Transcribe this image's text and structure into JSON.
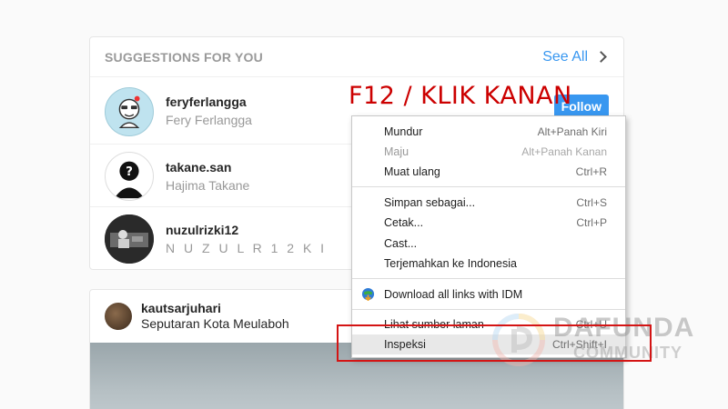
{
  "suggestions": {
    "title": "SUGGESTIONS FOR YOU",
    "see_all": "See All",
    "items": [
      {
        "username": "feryferlangga",
        "name": "Fery Ferlangga"
      },
      {
        "username": "takane.san",
        "name": "Hajima Takane"
      },
      {
        "username": "nuzulrizki12",
        "name": "N U Z U L R 1 2 K I"
      }
    ],
    "follow_label": "Follow"
  },
  "post": {
    "username": "kautsarjuhari",
    "location": "Seputaran Kota Meulaboh"
  },
  "annotation": "F12 / KLIK KANAN",
  "context_menu": {
    "items": [
      {
        "label": "Mundur",
        "shortcut": "Alt+Panah Kiri"
      },
      {
        "label": "Maju",
        "shortcut": "Alt+Panah Kanan"
      },
      {
        "label": "Muat ulang",
        "shortcut": "Ctrl+R"
      },
      {
        "label": "Simpan sebagai...",
        "shortcut": "Ctrl+S"
      },
      {
        "label": "Cetak...",
        "shortcut": "Ctrl+P"
      },
      {
        "label": "Cast...",
        "shortcut": ""
      },
      {
        "label": "Terjemahkan ke Indonesia",
        "shortcut": ""
      },
      {
        "label": "Download all links with IDM",
        "shortcut": ""
      },
      {
        "label": "Lihat sumber laman",
        "shortcut": "Ctrl+U"
      },
      {
        "label": "Inspeksi",
        "shortcut": "Ctrl+Shift+I"
      }
    ]
  },
  "watermark": {
    "line1": "DAFUNDA",
    "line2": "COMMUNITY"
  },
  "icons": {
    "chevron": "chevron-right-icon",
    "idm": "idm-globe-icon"
  },
  "colors": {
    "accent": "#3897f0",
    "annotation": "#cc0000",
    "highlight_box": "#d41414"
  }
}
